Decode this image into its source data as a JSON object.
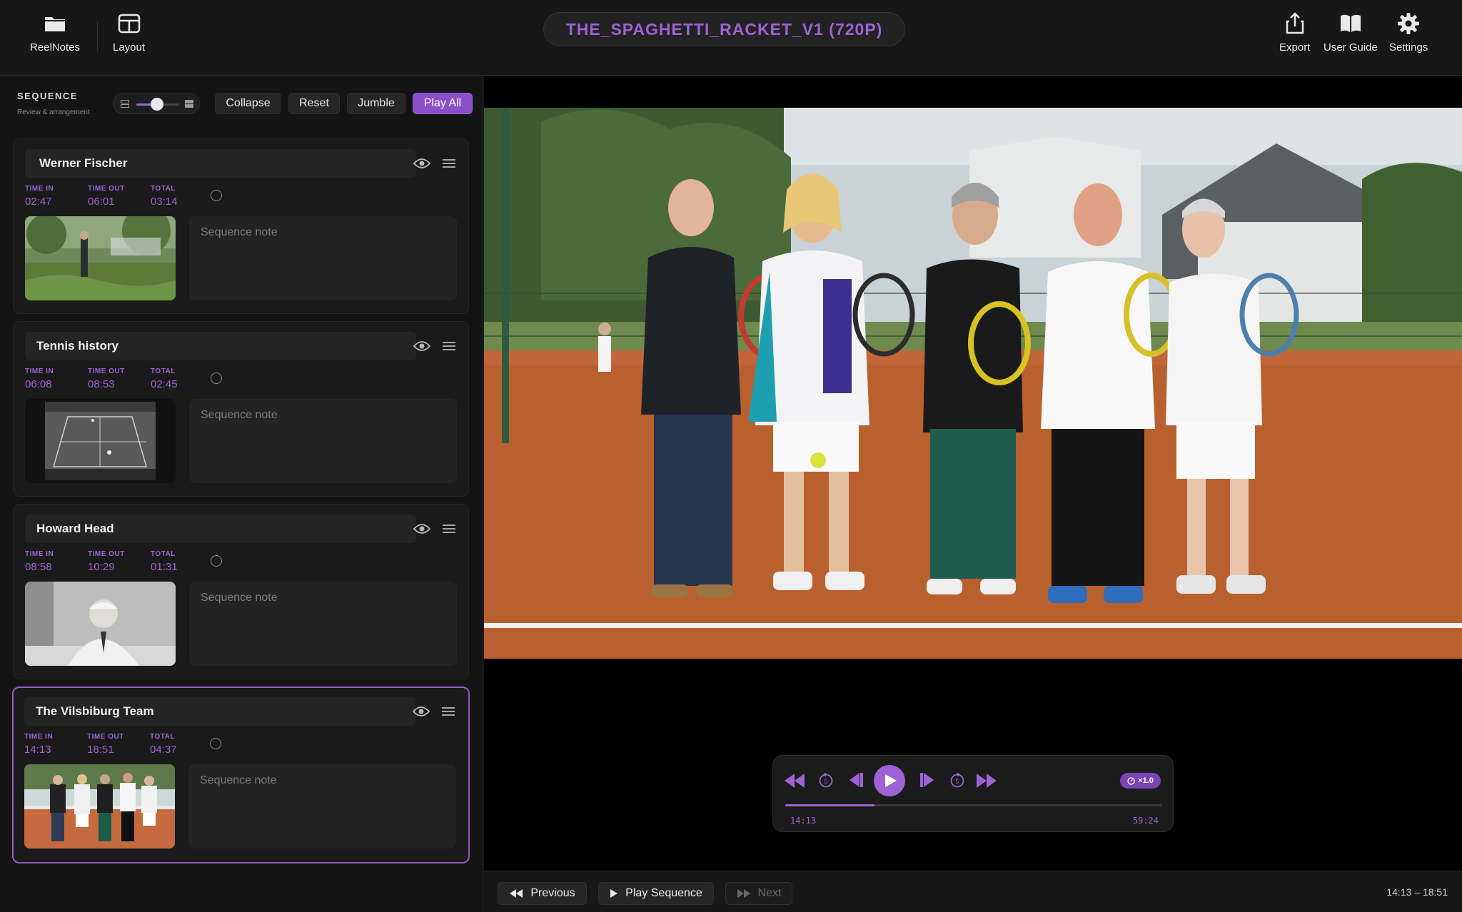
{
  "topbar": {
    "reelnotes": "ReelNotes",
    "layout": "Layout",
    "title": "THE_SPAGHETTI_RACKET_V1 (720P)",
    "export": "Export",
    "user_guide": "User Guide",
    "settings": "Settings"
  },
  "sequence": {
    "label": "SEQUENCE",
    "sub": "Review & arrangement",
    "density_level": 0.5,
    "collapse": "Collapse",
    "reset": "Reset",
    "jumble": "Jumble",
    "play_all": "Play All"
  },
  "labels": {
    "time_in": "TIME IN",
    "time_out": "TIME OUT",
    "total": "TOTAL",
    "note_placeholder": "Sequence note"
  },
  "cards": [
    {
      "title": "Werner Fischer",
      "time_in": "02:47",
      "time_out": "06:01",
      "total": "03:14",
      "active": false
    },
    {
      "title": "Tennis history",
      "time_in": "06:08",
      "time_out": "08:53",
      "total": "02:45",
      "active": false
    },
    {
      "title": "Howard Head",
      "time_in": "08:58",
      "time_out": "10:29",
      "total": "01:31",
      "active": false
    },
    {
      "title": "The Vilsbiburg Team",
      "time_in": "14:13",
      "time_out": "18:51",
      "total": "04:37",
      "active": true
    }
  ],
  "player": {
    "speed": "×1.0",
    "current_time": "14:13",
    "duration": "59:24",
    "progress": 0.238
  },
  "footer": {
    "previous": "Previous",
    "play_sequence": "Play Sequence",
    "next": "Next",
    "range": "14:13 – 18:51"
  },
  "colors": {
    "accent": "#9d63d6",
    "background": "#121212"
  },
  "icons": [
    "folder-icon",
    "layout-icon",
    "export-icon",
    "book-icon",
    "gear-icon",
    "eye-icon",
    "grip-icon",
    "play-icon",
    "rewind-icon",
    "fast-forward-icon"
  ]
}
